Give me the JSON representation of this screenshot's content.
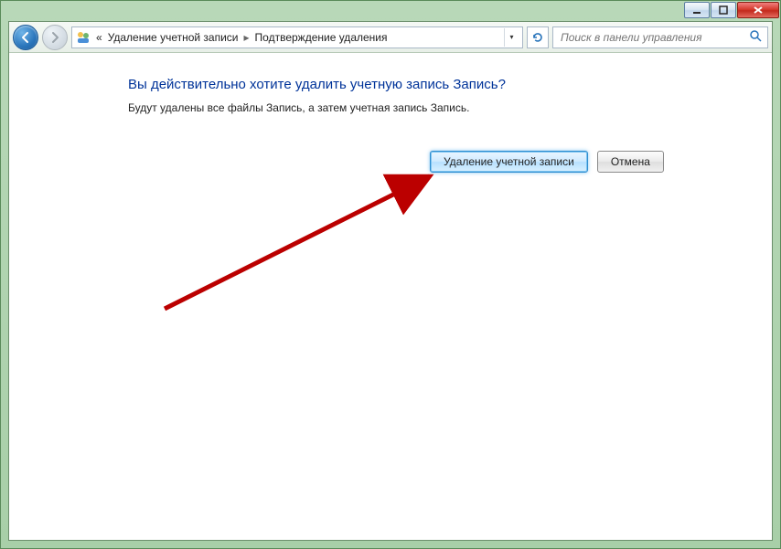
{
  "titlebar": {
    "minimize": "_",
    "maximize": "□",
    "close": "X"
  },
  "breadcrumb": {
    "prefix": "«",
    "item1": "Удаление учетной записи",
    "item2": "Подтверждение удаления"
  },
  "search": {
    "placeholder": "Поиск в панели управления"
  },
  "content": {
    "heading": "Вы действительно хотите удалить учетную запись Запись?",
    "subtext": "Будут удалены все файлы Запись, а затем учетная запись Запись.",
    "primary_button": "Удаление учетной записи",
    "cancel_button": "Отмена"
  }
}
